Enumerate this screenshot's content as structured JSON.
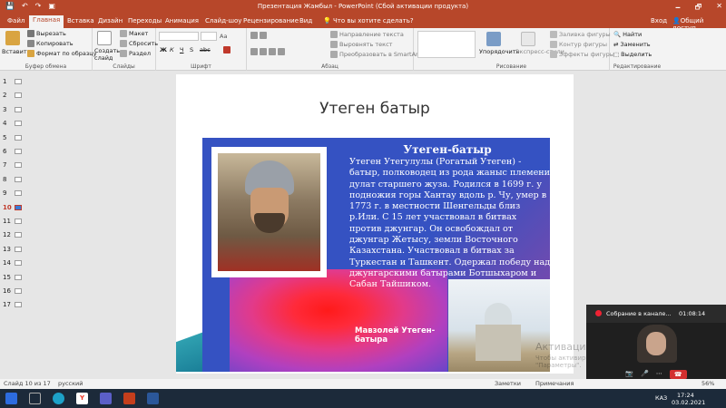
{
  "window": {
    "title": "Презентация Жамбыл - PowerPoint (Сбой активации продукта)",
    "qat": [
      "💾",
      "↶",
      "↷",
      "▣"
    ],
    "controls": [
      "🗕",
      "🗗",
      "✕"
    ]
  },
  "tabs": [
    "Файл",
    "Главная",
    "Вставка",
    "Дизайн",
    "Переходы",
    "Анимация",
    "Слайд-шоу",
    "Рецензирование",
    "Вид"
  ],
  "tell_me": "Что вы хотите сделать?",
  "account": {
    "signin": "Вход",
    "share": "Общий доступ"
  },
  "ribbon": {
    "clipboard": {
      "paste": "Вставить",
      "cut": "Вырезать",
      "copy": "Копировать",
      "format_painter": "Формат по образцу",
      "label": "Буфер обмена"
    },
    "slides": {
      "new_slide": "Создать слайд",
      "layout": "Макет",
      "reset": "Сбросить",
      "section": "Раздел",
      "label": "Слайды"
    },
    "font": {
      "bold": "Ж",
      "italic": "К",
      "underline": "Ч",
      "strike": "S",
      "spacing": "abc",
      "aa": "Аа",
      "label": "Шрифт"
    },
    "paragraph": {
      "direction": "Направление текста",
      "align": "Выровнять текст",
      "smartart": "Преобразовать в SmartArt",
      "label": "Абзац"
    },
    "drawing": {
      "arrange": "Упорядочить",
      "quick_styles": "Экспресс-стили",
      "fill": "Заливка фигуры",
      "outline": "Контур фигуры",
      "effects": "Эффекты фигуры",
      "label": "Рисование"
    },
    "editing": {
      "find": "Найти",
      "replace": "Заменить",
      "select": "Выделить",
      "label": "Редактирование"
    }
  },
  "thumbnails": [
    "1",
    "2",
    "3",
    "4",
    "5",
    "6",
    "7",
    "8",
    "9",
    "10",
    "11",
    "12",
    "13",
    "14",
    "15",
    "16",
    "17"
  ],
  "active_slide": 10,
  "slide": {
    "title": "Утеген батыр",
    "bio_heading": "Утеген-батыр",
    "bio_text": "Утеген Утегулулы (Рогатый Утеген) - батыр, полководец из рода жаныс племени дулат старшего жуза. Родился в 1699 г. у подножия горы Хантау вдоль р. Чу, умер в 1773 г. в местности Шенгельды близ р.Или. С 15 лет участвовал в битвах против джунгар. Он освобождал от джунгар Жетысу, земли Восточного Казахстана. Участвовал в битвах за Туркестан и Ташкент. Одержал победу над джунгарскими батырами Ботшыхаром и Сабан Тайшиком.",
    "mausoleum_label": "Мавзолей Утеген-батыра"
  },
  "video_call": {
    "title": "Собрание в канале...",
    "time": "01:08:14",
    "controls": [
      "📷",
      "🎤",
      "⋯"
    ]
  },
  "activation": {
    "line1": "Активация Windows",
    "line2": "Чтобы активировать Windows, перейдите в раздел \"Параметры\"."
  },
  "status": {
    "slide_of": "Слайд 10 из 17",
    "language": "русский",
    "notes": "Заметки",
    "comments": "Примечания",
    "zoom": "56%"
  },
  "taskbar": {
    "time": "17:24",
    "date": "03.02.2021",
    "lang": "КАЗ"
  },
  "colors": {
    "accent": "#b7472a",
    "slide_box": "#3552c2",
    "taskbar": "#1c2a3a"
  }
}
